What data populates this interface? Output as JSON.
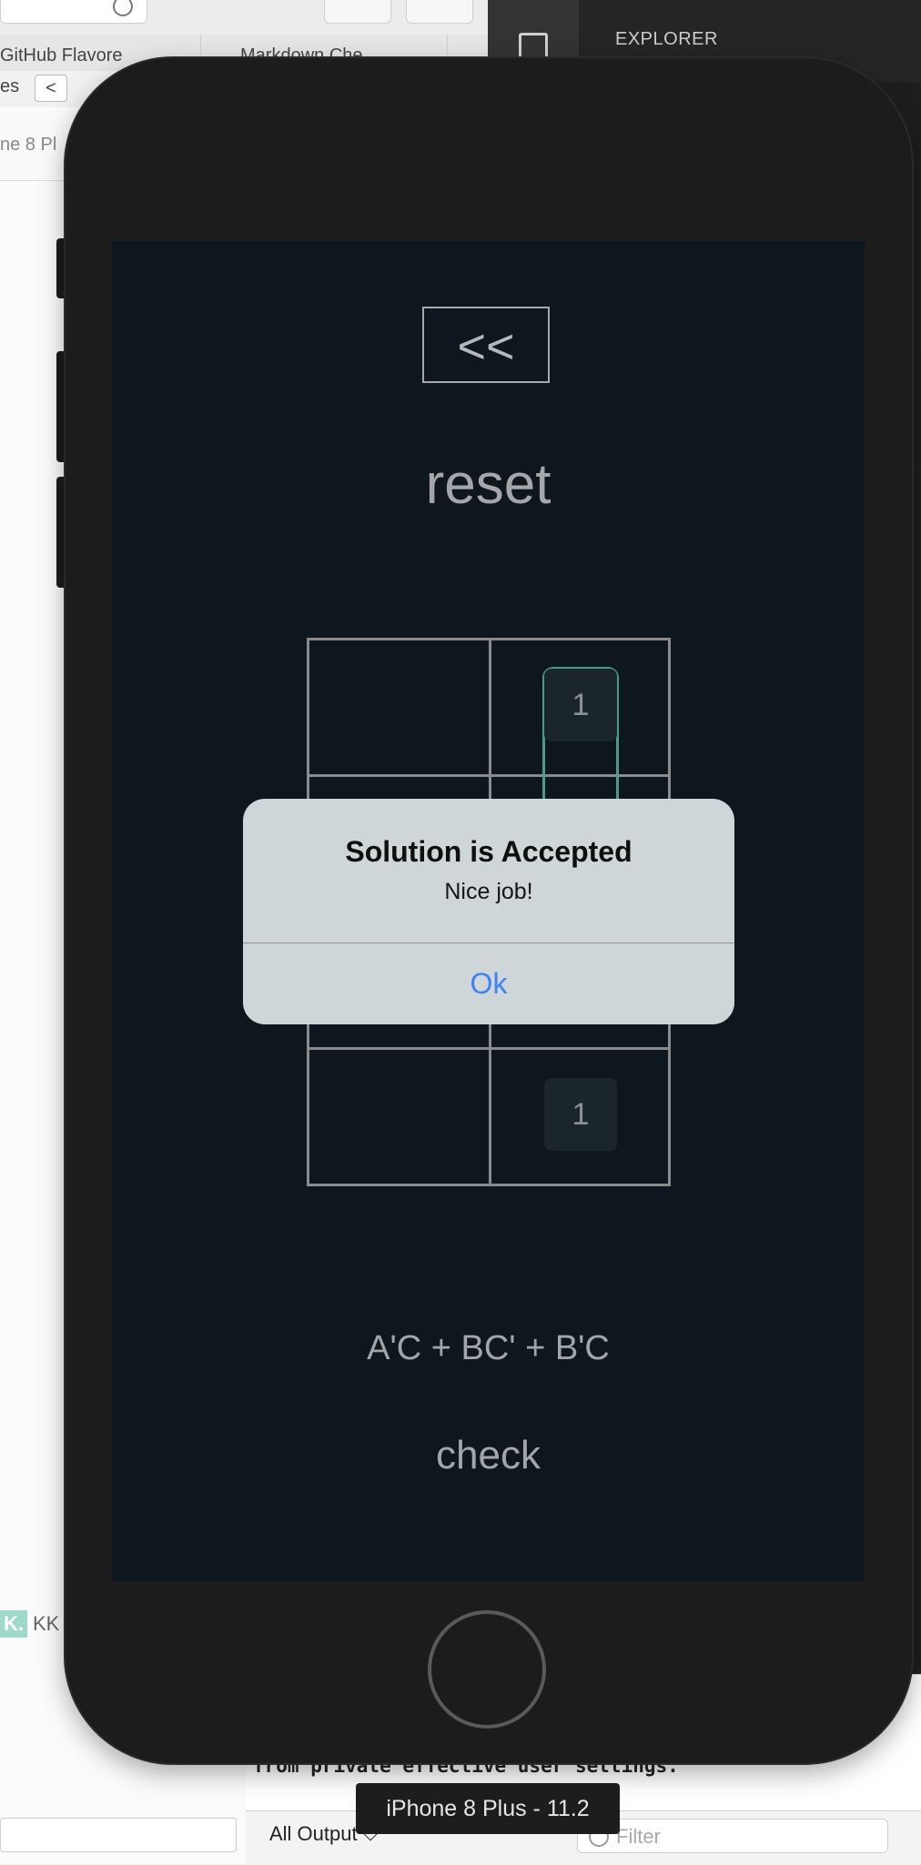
{
  "background": {
    "browser": {
      "tabs": [
        "GitHub Flavore",
        "Markdown Che"
      ],
      "nav_partial": "es",
      "address_partial": "ne 8 Pl",
      "kk_badge": "K.",
      "kk_label": "KK"
    },
    "editor": {
      "explorer_title": "EXPLORER",
      "console_line": "from private effective user settings.",
      "output_select": "All Output ⌵",
      "filter_placeholder": "Filter"
    }
  },
  "simulator": {
    "device_label": "iPhone 8 Plus - 11.2"
  },
  "app": {
    "back_label": "<<",
    "reset_label": "reset",
    "grid_cells": [
      [
        "",
        "1"
      ],
      [
        "",
        ""
      ],
      [
        "",
        ""
      ],
      [
        "",
        "1"
      ]
    ],
    "expression": "A'C + BC' + B'C",
    "check_label": "check"
  },
  "alert": {
    "title": "Solution is Accepted",
    "message": "Nice job!",
    "ok_label": "Ok"
  },
  "colors": {
    "screen_bg": "#0e171d",
    "group_outline": "#4d9a8b",
    "alert_bg": "#cfd6d8",
    "ok_blue": "#3b82f2"
  }
}
